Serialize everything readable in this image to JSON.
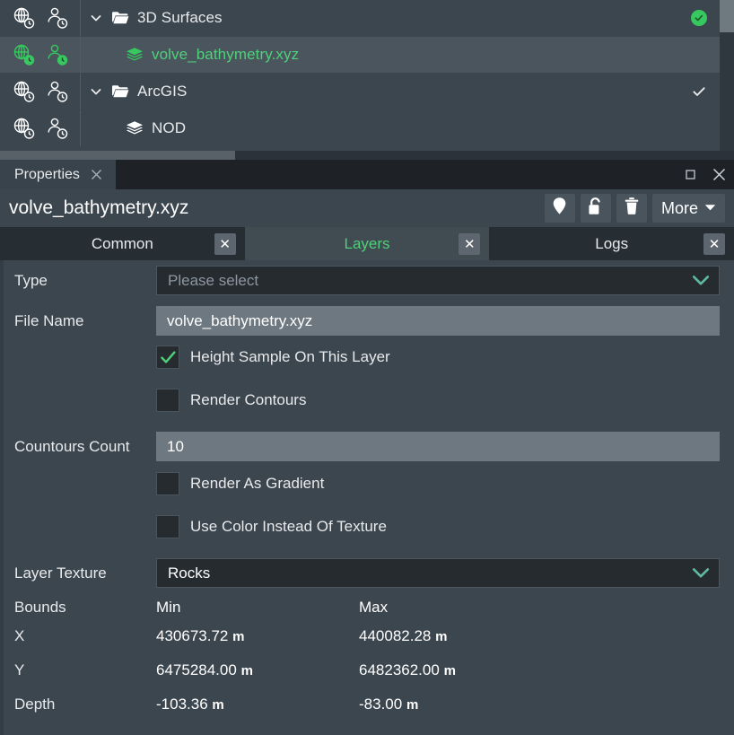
{
  "tree": {
    "rows": [
      {
        "label": "3D Surfaces",
        "kind": "folder",
        "expanded": true,
        "selected": false,
        "green": false,
        "mark": "badge-check",
        "icons": [
          "globe-clock-icon",
          "user-clock-icon"
        ],
        "icon_state": "white"
      },
      {
        "label": "volve_bathymetry.xyz",
        "kind": "layer",
        "expanded": false,
        "selected": true,
        "green": true,
        "mark": "none",
        "icons": [
          "globe-clock-icon",
          "user-clock-icon"
        ],
        "icon_state": "green"
      },
      {
        "label": "ArcGIS",
        "kind": "folder",
        "expanded": true,
        "selected": false,
        "green": false,
        "mark": "check",
        "icons": [
          "globe-clock-icon",
          "user-clock-icon"
        ],
        "icon_state": "white"
      },
      {
        "label": "NOD",
        "kind": "layer",
        "expanded": false,
        "selected": false,
        "green": false,
        "mark": "none",
        "icons": [
          "globe-clock-icon",
          "user-clock-icon"
        ],
        "icon_state": "white"
      }
    ]
  },
  "dock": {
    "tab_label": "Properties",
    "tab_close_icon": "close-icon",
    "maximize_icon": "maximize-icon",
    "close_icon": "close-icon",
    "title": "volve_bathymetry.xyz",
    "tools": [
      {
        "name": "location-pin-icon"
      },
      {
        "name": "unlock-icon"
      },
      {
        "name": "trash-icon"
      }
    ],
    "more_label": "More",
    "more_arrow_icon": "chevron-down-icon"
  },
  "tabs": [
    {
      "label": "Common",
      "active": false,
      "close": "✕"
    },
    {
      "label": "Layers",
      "active": true,
      "close": "✕"
    },
    {
      "label": "Logs",
      "active": false,
      "close": "✕"
    }
  ],
  "form": {
    "type": {
      "label": "Type",
      "value": "Please select",
      "is_placeholder": true
    },
    "file_name": {
      "label": "File Name",
      "value": "volve_bathymetry.xyz"
    },
    "height_sample": {
      "label": "Height Sample On This Layer",
      "checked": true
    },
    "render_contours": {
      "label": "Render Contours",
      "checked": false
    },
    "contours_count": {
      "label": "Countours Count",
      "value": "10"
    },
    "render_gradient": {
      "label": "Render As Gradient",
      "checked": false
    },
    "use_color": {
      "label": "Use Color Instead Of Texture",
      "checked": false
    },
    "layer_texture": {
      "label": "Layer Texture",
      "value": "Rocks",
      "is_placeholder": false
    },
    "bounds": {
      "label": "Bounds",
      "min_header": "Min",
      "max_header": "Max",
      "rows": [
        {
          "label": "X",
          "min": "430673.72",
          "max": "440082.28",
          "unit": "m"
        },
        {
          "label": "Y",
          "min": "6475284.00",
          "max": "6482362.00",
          "unit": "m"
        },
        {
          "label": "Depth",
          "min": "-103.36",
          "max": "-83.00",
          "unit": "m"
        }
      ]
    }
  },
  "colors": {
    "panel_bg": "#3c464f",
    "accent_green": "#4fd07a",
    "badge_green": "#37c95f",
    "teal_arrow": "#5fb9a0",
    "input_gray": "#6e7880",
    "dark_input": "#262b30"
  }
}
